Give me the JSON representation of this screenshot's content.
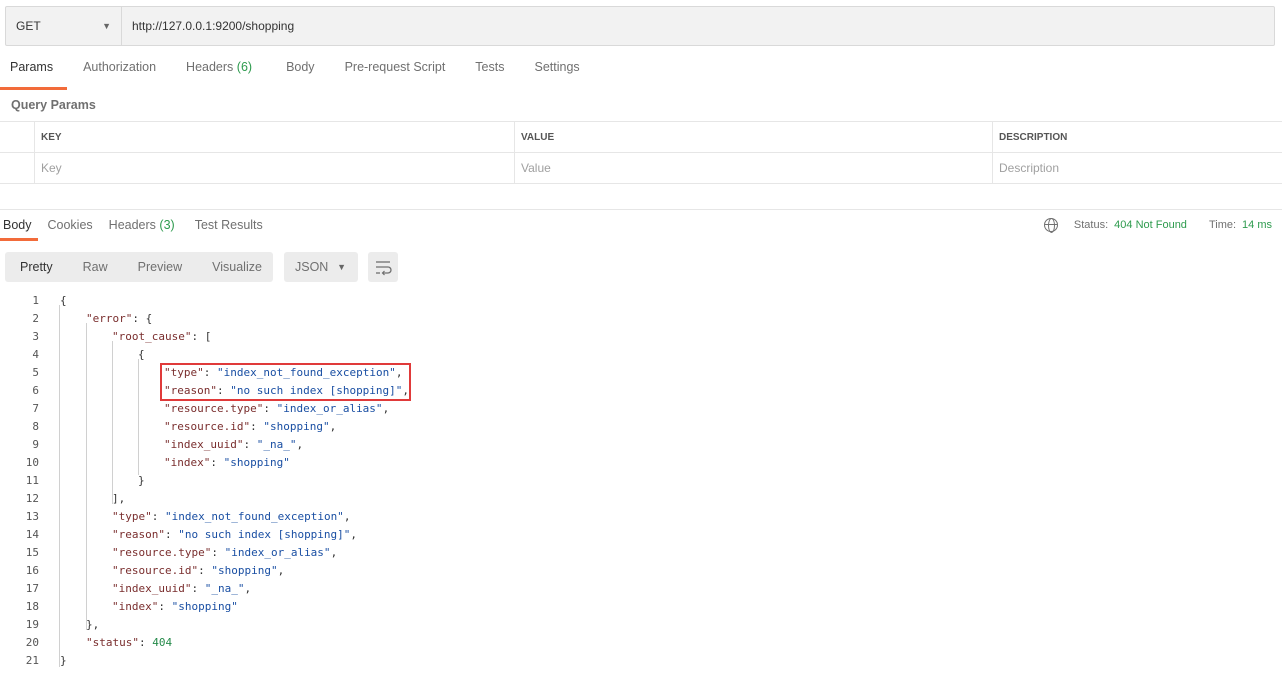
{
  "request": {
    "method": "GET",
    "url": "http://127.0.0.1:9200/shopping"
  },
  "request_tabs": [
    {
      "label": "Params",
      "count": ""
    },
    {
      "label": "Authorization",
      "count": ""
    },
    {
      "label": "Headers",
      "count": "(6)"
    },
    {
      "label": "Body",
      "count": ""
    },
    {
      "label": "Pre-request Script",
      "count": ""
    },
    {
      "label": "Tests",
      "count": ""
    },
    {
      "label": "Settings",
      "count": ""
    }
  ],
  "query_params": {
    "title": "Query Params",
    "headers": {
      "key": "KEY",
      "value": "VALUE",
      "description": "DESCRIPTION"
    },
    "placeholders": {
      "key": "Key",
      "value": "Value",
      "description": "Description"
    }
  },
  "response_tabs": [
    {
      "label": "Body",
      "count": ""
    },
    {
      "label": "Cookies",
      "count": ""
    },
    {
      "label": "Headers",
      "count": "(3)"
    },
    {
      "label": "Test Results",
      "count": ""
    }
  ],
  "response_status": {
    "status_label": "Status:",
    "status_value": "404 Not Found",
    "time_label": "Time:",
    "time_value": "14 ms"
  },
  "view_options": [
    "Pretty",
    "Raw",
    "Preview",
    "Visualize"
  ],
  "format": "JSON",
  "icons": {
    "globe": "globe-icon",
    "wrap": "wrap-lines-icon",
    "caret": "chevron-down-icon"
  },
  "colors": {
    "accent": "#f26b3a",
    "success": "#2e9b4e",
    "highlight": "#e03a3a"
  },
  "code_lines": [
    {
      "n": "1",
      "t": "{"
    },
    {
      "n": "2",
      "t": "\"error\": {"
    },
    {
      "n": "3",
      "t": "\"root_cause\": ["
    },
    {
      "n": "4",
      "t": "{"
    },
    {
      "n": "5",
      "t": "\"type\": \"index_not_found_exception\","
    },
    {
      "n": "6",
      "t": "\"reason\": \"no such index [shopping]\","
    },
    {
      "n": "7",
      "t": "\"resource.type\": \"index_or_alias\","
    },
    {
      "n": "8",
      "t": "\"resource.id\": \"shopping\","
    },
    {
      "n": "9",
      "t": "\"index_uuid\": \"_na_\","
    },
    {
      "n": "10",
      "t": "\"index\": \"shopping\""
    },
    {
      "n": "11",
      "t": "}"
    },
    {
      "n": "12",
      "t": "],"
    },
    {
      "n": "13",
      "t": "\"type\": \"index_not_found_exception\","
    },
    {
      "n": "14",
      "t": "\"reason\": \"no such index [shopping]\","
    },
    {
      "n": "15",
      "t": "\"resource.type\": \"index_or_alias\","
    },
    {
      "n": "16",
      "t": "\"resource.id\": \"shopping\","
    },
    {
      "n": "17",
      "t": "\"index_uuid\": \"_na_\","
    },
    {
      "n": "18",
      "t": "\"index\": \"shopping\""
    },
    {
      "n": "19",
      "t": "},"
    },
    {
      "n": "20",
      "t": "\"status\": 404"
    },
    {
      "n": "21",
      "t": "}"
    }
  ]
}
